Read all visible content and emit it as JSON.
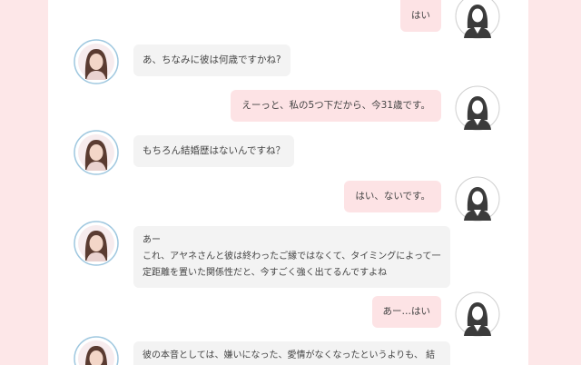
{
  "conversation": {
    "messages": [
      {
        "side": "right",
        "speaker": "user",
        "text": "はい"
      },
      {
        "side": "left",
        "speaker": "counselor",
        "text": "あ、ちなみに彼は何歳ですかね?"
      },
      {
        "side": "right",
        "speaker": "user",
        "text": "えーっと、私の5つ下だから、今31歳です。"
      },
      {
        "side": "left",
        "speaker": "counselor",
        "text": "もちろん結婚歴はないんですね？"
      },
      {
        "side": "right",
        "speaker": "user",
        "text": "はい、ないです。"
      },
      {
        "side": "left",
        "speaker": "counselor",
        "lines": [
          "あー",
          "これ、アヤネさんと彼は終わったご縁ではなくて、タイミングによって一",
          "定距離を置いた関係性だと、今すごく強く出てるんですよね"
        ]
      },
      {
        "side": "right",
        "speaker": "user",
        "text": "あー…はい"
      },
      {
        "side": "left",
        "speaker": "counselor",
        "text": "彼の本音としては、嫌いになった、愛情がなくなったというよりも、 結"
      }
    ]
  },
  "colors": {
    "page_background": "#fde7e8",
    "panel_background": "#ffffff",
    "left_bubble": "#f3f3f3",
    "right_bubble": "#fde3e5",
    "avatar_frame": "#9ec7df"
  },
  "icons": {
    "user_avatar": "woman-silhouette-icon",
    "counselor_avatar": "counselor-portrait-icon"
  }
}
